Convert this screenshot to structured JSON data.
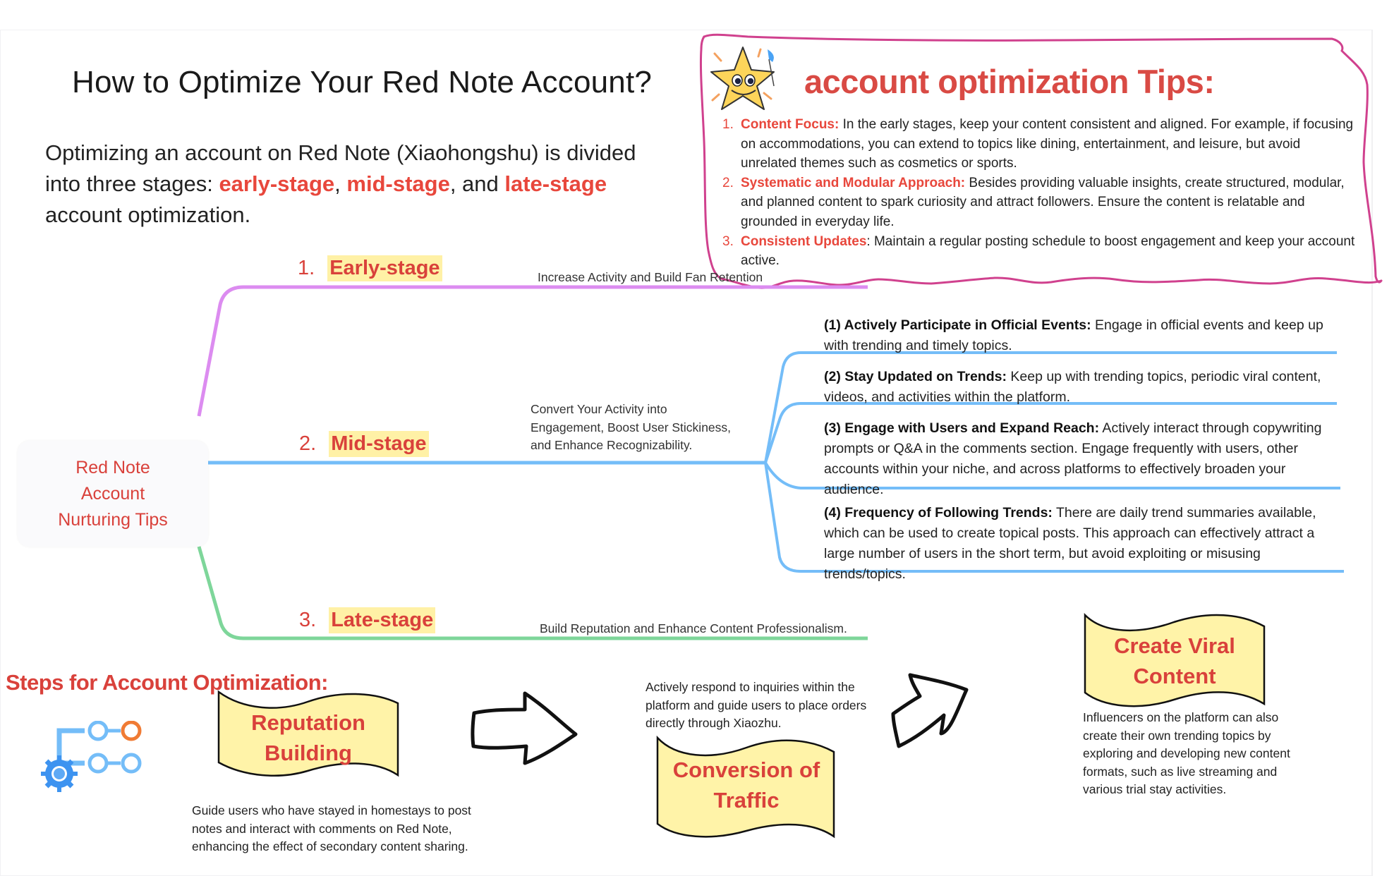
{
  "title": "How to Optimize Your Red Note Account?",
  "intro": {
    "text_before": "Optimizing an account on Red Note (Xiaohongshu) is divided into three stages: ",
    "highlight_1": "early-stage",
    "sep_1": ", ",
    "highlight_2": "mid-stage",
    "sep_2": ", and ",
    "highlight_3": "late-stage",
    "text_after": " account optimization."
  },
  "tips": {
    "icon": "star-mascot-icon",
    "title": "account optimization Tips:",
    "border_color": "#d0418e",
    "items": [
      {
        "num": "1.",
        "label": "Content Focus:",
        "text": " In the early stages, keep your content consistent and aligned. For example, if focusing on accommodations, you can extend to topics like dining, entertainment, and leisure, but avoid unrelated themes such as cosmetics or sports."
      },
      {
        "num": "2.",
        "label": "Systematic and Modular Approach:",
        "text": " Besides providing valuable insights, create structured, modular, and planned content to spark curiosity and attract followers. Ensure the content is relatable and grounded in everyday life."
      },
      {
        "num": "3.",
        "label": "Consistent Updates",
        "text": ": Maintain a regular posting schedule to boost engagement and keep your account active."
      }
    ]
  },
  "mindmap": {
    "root": "Red Note Account Nurturing Tips",
    "stages": [
      {
        "num": "1.",
        "label": "Early-stage",
        "note": "Increase Activity and Build Fan Retention",
        "color": "#dc8cf0"
      },
      {
        "num": "2.",
        "label": "Mid-stage",
        "note": "Convert Your Activity into Engagement, Boost User Stickiness, and Enhance Recognizability.",
        "color": "#74bdf8"
      },
      {
        "num": "3.",
        "label": "Late-stage",
        "note": "Build Reputation and Enhance Content Professionalism.",
        "color": "#7ed69a"
      }
    ],
    "mid_items": [
      {
        "label": "(1) Actively Participate in Official Events:",
        "text": " Engage in official events and keep up with trending and timely topics."
      },
      {
        "label": "(2) Stay Updated on Trends:",
        "text": " Keep up with trending topics, periodic viral content, videos, and activities within the platform."
      },
      {
        "label": "(3) Engage with Users and Expand Reach:",
        "text": " Actively interact through copywriting prompts or Q&A in the comments section. Engage frequently with users, other accounts within your niche, and across platforms to effectively broaden your audience."
      },
      {
        "label": "(4) Frequency of Following Trends:",
        "text": " There are daily trend summaries available, which can be used to create topical posts. This approach can effectively attract a large number of users in the short term, but avoid exploiting or misusing trends/topics."
      }
    ]
  },
  "steps": {
    "heading": "Steps for Account Optimization:",
    "icon": "workflow-gear-icon",
    "items": [
      {
        "title": "Reputation Building",
        "desc": "Guide users who have stayed in homestays to post notes and interact with comments on Red Note, enhancing the effect of secondary content sharing."
      },
      {
        "title": "Conversion of Traffic",
        "desc": "Actively respond to inquiries within the platform and guide users to place orders directly through Xiaozhu."
      },
      {
        "title": "Create Viral Content",
        "desc": "Influencers on the platform can also create their own trending topics by exploring and developing new content formats, such as live streaming and various trial stay activities."
      }
    ]
  },
  "colors": {
    "accent_red": "#d9413b",
    "highlight_yellow": "#fff1a6",
    "banner_fill": "#fff3a8"
  }
}
